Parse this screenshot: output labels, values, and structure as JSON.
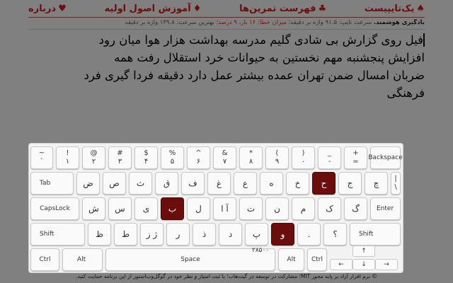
{
  "nav": [
    {
      "label": "یک‌تایپیست",
      "icon": "♠"
    },
    {
      "label": "فهرست تمرین‌ها",
      "icon": "♣"
    },
    {
      "label": "آموزش اصول اولیه",
      "icon": "♦"
    },
    {
      "label": "درباره",
      "icon": "♥"
    }
  ],
  "stats": {
    "label": "بادگیری هوشمند.",
    "speed": "سرعت تایپ: ۹۱.۵ واژه بر دقیقه؛",
    "errors": "میزان خطا: ۱۶ بار، ۹ درصد؛",
    "best": "بهترین سرعت: ۱۳۹.۸ واژه بر دقیقه"
  },
  "text": {
    "lines": [
      "فیل روی گزارش بی شادی گلیم مدرسه بهداشت هزار هوا میان رود",
      "افزایش پنجشنبه مهم نخستین به حیوانات خرد استقلال رفت همه",
      "ضربان امسال ضمن تهران عمده بیشتر عمل دارد دقیقه فردا گیری فرد",
      "فرهنگی"
    ]
  },
  "keyboard": {
    "row1": [
      {
        "t": "~",
        "b": "`"
      },
      {
        "t": "!",
        "b": "۱"
      },
      {
        "t": "@",
        "b": "۲"
      },
      {
        "t": "#",
        "b": "۳"
      },
      {
        "t": "%",
        "b": "۵"
      },
      {
        "t": "",
        "b": "۶"
      },
      {
        "t": "&",
        "b": "۷"
      },
      {
        "t": "*",
        "b": "۸"
      },
      {
        "t": "(",
        "b": "۹"
      },
      {
        "t": ")",
        "b": "۰"
      },
      {
        "t": "_",
        "b": "-"
      },
      {
        "t": "+",
        "b": "="
      }
    ],
    "backspace": "Backspace",
    "tab": "Tab",
    "row2": [
      "ض",
      "ص",
      "ث",
      "ق",
      "ف",
      "غ",
      "ع",
      "ه",
      "خ",
      "ح",
      "ج",
      "چ"
    ],
    "backslash": {
      "t": "|",
      "b": "\\"
    },
    "capslock": "CapsLock",
    "row3": [
      "ش",
      "س",
      "ی",
      "ب",
      "ل",
      "آ ا",
      "ت",
      "ن",
      "م",
      "ک",
      "گ"
    ],
    "enter": "Enter",
    "shift": "Shift",
    "row4": [
      "ظ",
      "ط",
      "ژ ز",
      "ر",
      "ذ",
      "د",
      "پ",
      "و",
      ".",
      "؟"
    ],
    "ctrl": "Ctrl",
    "alt": "Alt",
    "space": "Space",
    "ime": "۲۸۵۰۰",
    "arrows": {
      "up": "↑",
      "left": "←",
      "down": "↓",
      "right": "→"
    }
  },
  "colors": {
    "accent": "#6b0d0d",
    "background": "#808080"
  },
  "footer": {
    "text": "© نرم افزار آزاد بر پایه مجوز MIT؛ مشارکت در توسعه در گیت‌هاب؛ با ثبت امتیاز و نظر خود در گوگل‌وب‌استور از این برنامه حمایت کنید."
  }
}
